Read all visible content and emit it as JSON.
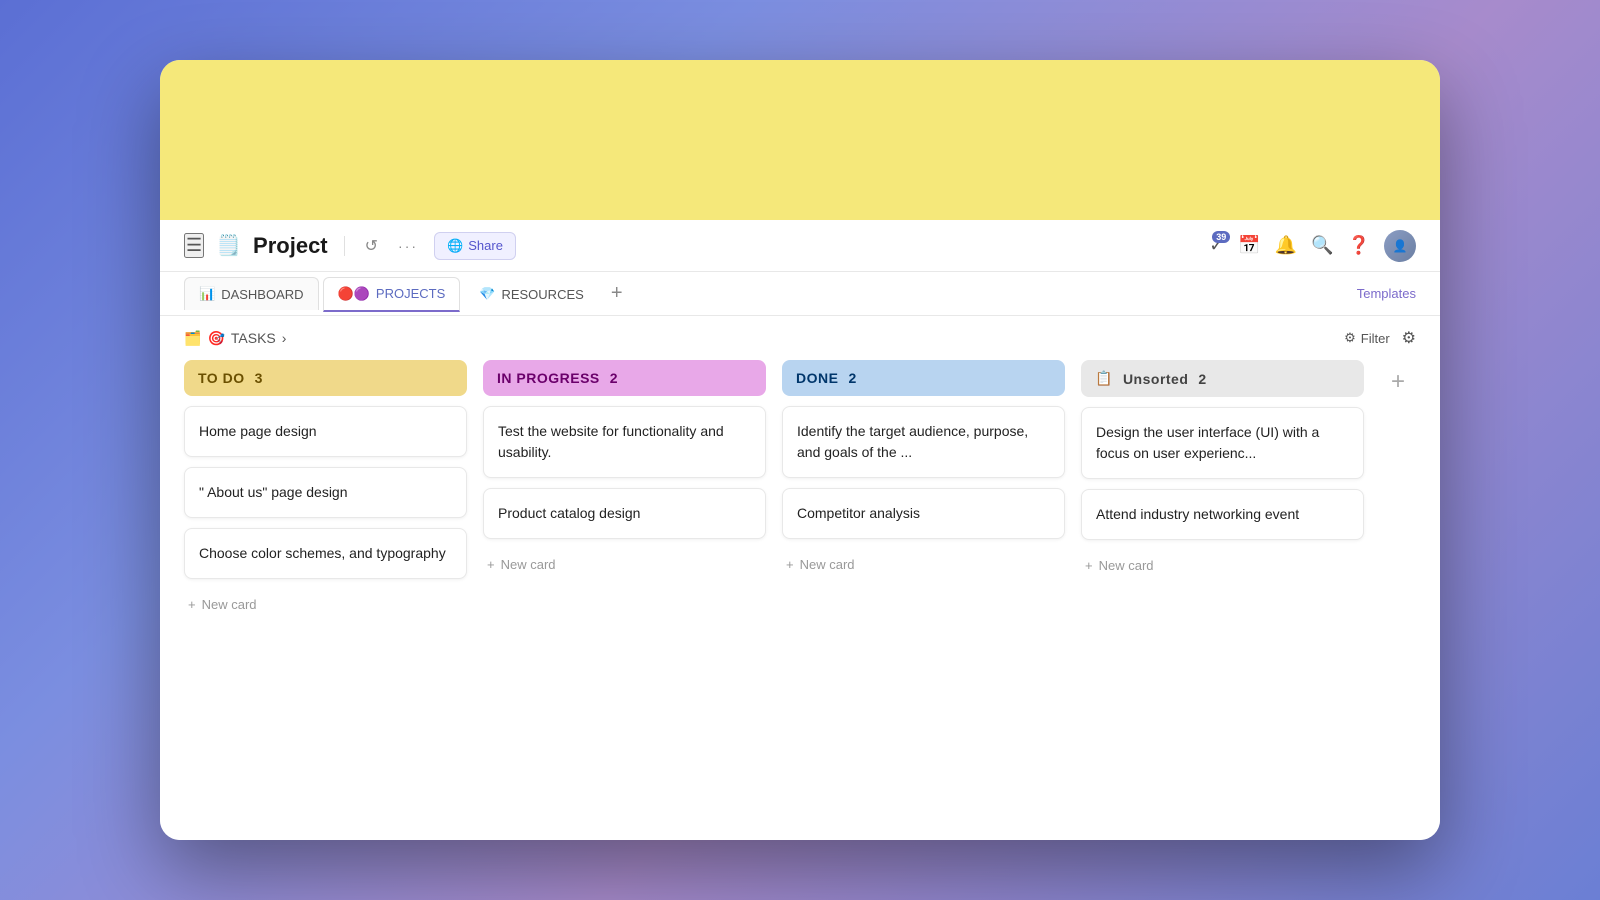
{
  "app": {
    "page_icon": "🗒️",
    "page_title": "Project",
    "share_label": "Share",
    "share_icon": "🌐",
    "templates_label": "Templates",
    "badge_count": "39"
  },
  "tabs": [
    {
      "id": "dashboard",
      "label": "DASHBOARD",
      "icon": "📊",
      "active": false
    },
    {
      "id": "projects",
      "label": "PROJECTS",
      "icon": "🔴🟣",
      "active": true
    },
    {
      "id": "resources",
      "label": "RESOURCES",
      "icon": "💎",
      "active": false
    }
  ],
  "tasks_breadcrumb": {
    "icon1": "🗂️",
    "icon2": "🎯",
    "label": "TASKS",
    "chevron": "›"
  },
  "filter": {
    "label": "Filter"
  },
  "columns": [
    {
      "id": "todo",
      "label": "TO DO",
      "count": 3,
      "style": "todo",
      "cards": [
        {
          "text": "Home page design"
        },
        {
          "text": "\" About us\" page design"
        },
        {
          "text": "Choose color schemes, and typography"
        }
      ],
      "new_card_label": "New card"
    },
    {
      "id": "inprogress",
      "label": "IN PROGRESS",
      "count": 2,
      "style": "inprogress",
      "cards": [
        {
          "text": "Test the website for functionality and usability."
        },
        {
          "text": "Product catalog design"
        }
      ],
      "new_card_label": "New card"
    },
    {
      "id": "done",
      "label": "DONE",
      "count": 2,
      "style": "done",
      "cards": [
        {
          "text": "Identify the target audience, purpose, and goals of the ..."
        },
        {
          "text": "Competitor analysis"
        }
      ],
      "new_card_label": "New card"
    },
    {
      "id": "unsorted",
      "label": "Unsorted",
      "count": 2,
      "style": "unsorted",
      "icon": "📋",
      "cards": [
        {
          "text": "Design the user interface (UI) with a focus on user experienc..."
        },
        {
          "text": "Attend industry networking event"
        }
      ],
      "new_card_label": "New card"
    }
  ],
  "add_column_icon": "+"
}
